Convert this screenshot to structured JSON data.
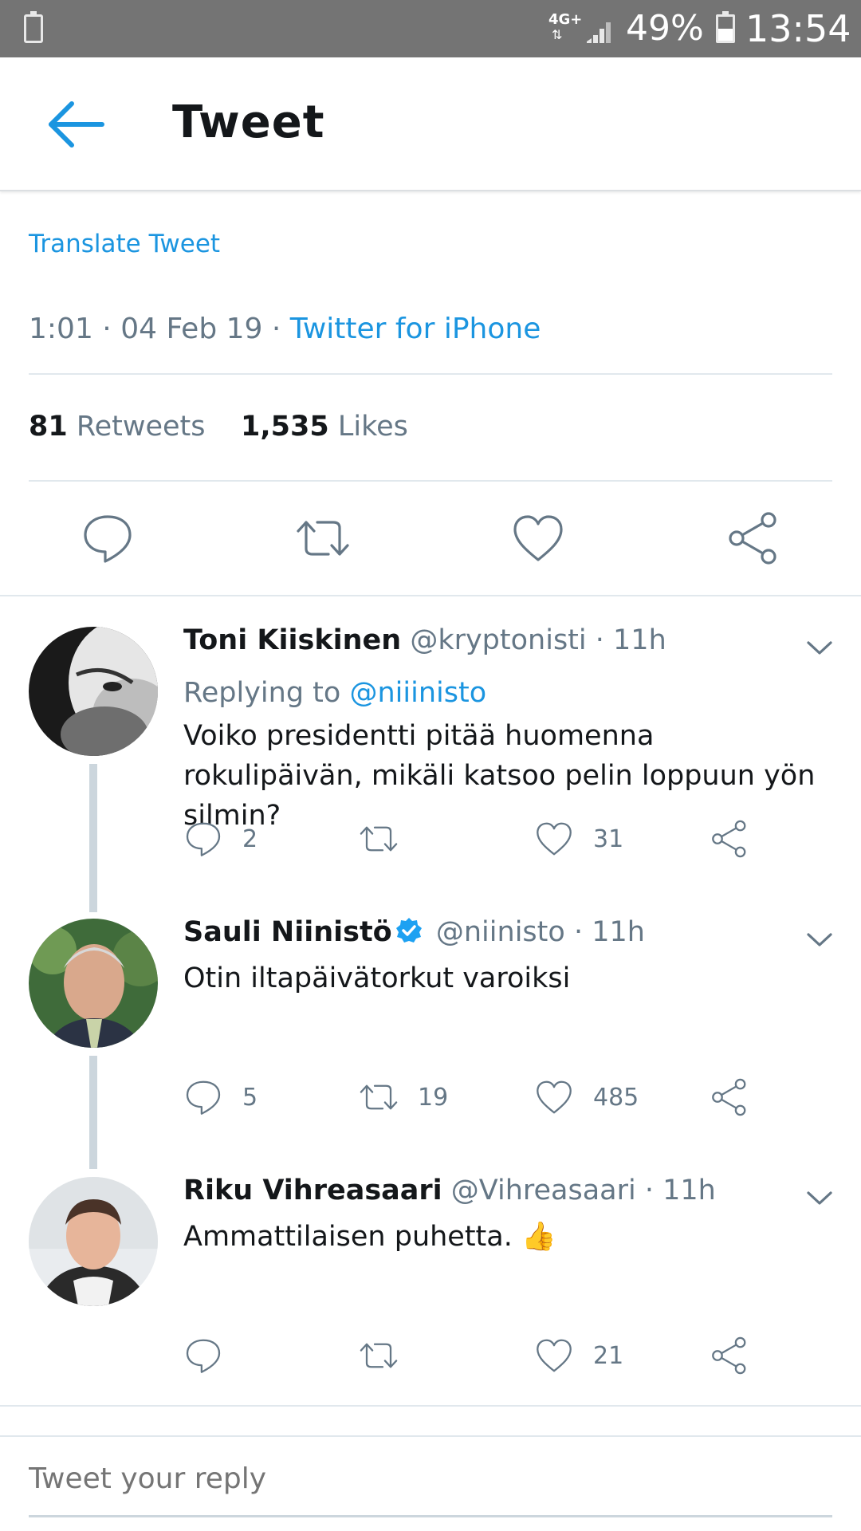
{
  "status_bar": {
    "network": "4G+",
    "network_arrows": "⇅",
    "battery_percent": "49%",
    "battery_level": 0.49,
    "time": "13:54"
  },
  "header": {
    "title": "Tweet",
    "back_icon": "arrow-left-icon"
  },
  "tweet": {
    "translate_label": "Translate Tweet",
    "time": "1:01",
    "date": "04 Feb 19",
    "source": "Twitter for iPhone",
    "retweets_count": "81",
    "retweets_label": "Retweets",
    "likes_count": "1,535",
    "likes_label": "Likes"
  },
  "replies": [
    {
      "name": "Toni Kiiskinen",
      "handle": "@kryptonisti",
      "time": "· 11h",
      "replying_label": "Replying to",
      "replying_to": "@niiinisto",
      "text": "Voiko presidentti pitää huomenna rokulipäivän, mikäli katsoo pelin loppuun yön silmin?",
      "reply_count": "2",
      "retweet_count": "",
      "like_count": "31",
      "verified": false
    },
    {
      "name": "Sauli Niinistö",
      "handle": "@niinisto",
      "time": "· 11h",
      "text": "Otin iltapäivätorkut varoiksi",
      "reply_count": "5",
      "retweet_count": "19",
      "like_count": "485",
      "verified": true
    },
    {
      "name": "Riku Vihreasaari",
      "handle": "@Vihreasaari",
      "time": "· 11h",
      "text": "Ammattilaisen puhetta. 👍",
      "reply_count": "",
      "retweet_count": "",
      "like_count": "21",
      "verified": false
    }
  ],
  "composer": {
    "placeholder": "Tweet your reply"
  },
  "colors": {
    "accent": "#1b95e0",
    "secondary_text": "#657786",
    "status_bar": "#747474"
  }
}
